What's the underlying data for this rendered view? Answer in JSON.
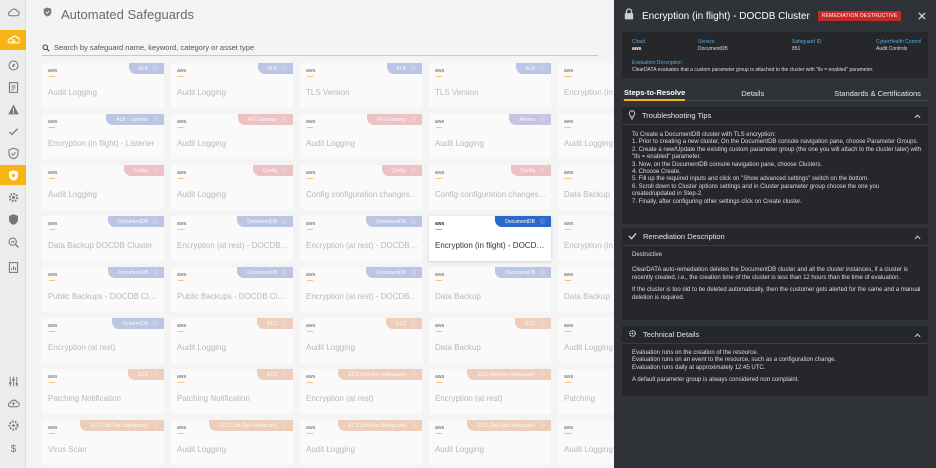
{
  "app": {
    "title": "Automated Safeguards"
  },
  "search": {
    "placeholder": "Search by safeguard name, keyword, category or asset type"
  },
  "colors": {
    "accent": "#f6b515",
    "panel_bg": "#2f3237",
    "remediation": "#c62828",
    "link": "#5fa9d8"
  },
  "rail": {
    "icons": [
      "cloud-icon",
      "cloud-shield-icon",
      "compass-icon",
      "list-icon",
      "alert-icon",
      "checkmark-icon",
      "shield-icon",
      "shield-active-icon",
      "gear-icon",
      "shield-check-icon",
      "search-analytics-icon",
      "report-icon",
      "sliders-icon",
      "cloud-upload-icon",
      "settings-icon",
      "dollar-icon"
    ]
  },
  "cards": [
    {
      "col": 0,
      "row": 0,
      "tag": "ALB",
      "color": "blue",
      "title": "Audit Logging"
    },
    {
      "col": 1,
      "row": 0,
      "tag": "ALB",
      "color": "blue",
      "title": "Audit Logging"
    },
    {
      "col": 2,
      "row": 0,
      "tag": "ALB",
      "color": "blue",
      "title": "TLS Version"
    },
    {
      "col": 3,
      "row": 0,
      "tag": "ALB",
      "color": "blue",
      "title": "TLS Version"
    },
    {
      "col": 4,
      "row": 0,
      "tag": "",
      "color": "blue",
      "title": "Encryption (in fli"
    },
    {
      "col": 0,
      "row": 1,
      "tag": "ALB - Listener",
      "color": "blue",
      "title": "Encryption (in flight) - Listener"
    },
    {
      "col": 1,
      "row": 1,
      "tag": "API Gateway",
      "color": "pink",
      "title": "Audit Logging"
    },
    {
      "col": 2,
      "row": 1,
      "tag": "API Gateway",
      "color": "pink",
      "title": "Audit Logging"
    },
    {
      "col": 3,
      "row": 1,
      "tag": "Athena",
      "color": "violet",
      "title": "Audit Logging"
    },
    {
      "col": 4,
      "row": 1,
      "tag": "",
      "color": "blue",
      "title": "Audit Logging"
    },
    {
      "col": 0,
      "row": 2,
      "tag": "Config",
      "color": "pink",
      "title": "Audit Logging"
    },
    {
      "col": 1,
      "row": 2,
      "tag": "Config",
      "color": "pink",
      "title": "Audit Logging"
    },
    {
      "col": 2,
      "row": 2,
      "tag": "Config",
      "color": "pink",
      "title": "Config configuration changes (A..."
    },
    {
      "col": 3,
      "row": 2,
      "tag": "Config",
      "color": "pink",
      "title": "Config configuration changes (A..."
    },
    {
      "col": 4,
      "row": 2,
      "tag": "",
      "color": "blue",
      "title": "Data Backup"
    },
    {
      "col": 0,
      "row": 3,
      "tag": "DocumentDB",
      "color": "blue",
      "title": "Data Backup DOCDB Cluster"
    },
    {
      "col": 1,
      "row": 3,
      "tag": "DocumentDB",
      "color": "blue",
      "title": "Encryption (at rest) - DOCDB Cl..."
    },
    {
      "col": 2,
      "row": 3,
      "tag": "DocumentDB",
      "color": "blue",
      "title": "Encryption (at rest) - DOCDB Cl..."
    },
    {
      "col": 3,
      "row": 3,
      "tag": "DocumentDB",
      "color": "darkblue",
      "title": "Encryption (in flight) - DOCDB Cl...",
      "focus": true
    },
    {
      "col": 4,
      "row": 3,
      "tag": "",
      "color": "blue",
      "title": "Encryption (in fli"
    },
    {
      "col": 0,
      "row": 4,
      "tag": "DocumentDB",
      "color": "blue",
      "title": "Public Backups - DOCDB Cluster"
    },
    {
      "col": 1,
      "row": 4,
      "tag": "DocumentDB",
      "color": "blue",
      "title": "Public Backups - DOCDB Cluster"
    },
    {
      "col": 2,
      "row": 4,
      "tag": "DocumentDB",
      "color": "blue",
      "title": "Encryption (at rest) - DOCDB Cl..."
    },
    {
      "col": 3,
      "row": 4,
      "tag": "DocumentDB",
      "color": "blue",
      "title": "Data Backup"
    },
    {
      "col": 4,
      "row": 4,
      "tag": "",
      "color": "blue",
      "title": "Data Backup"
    },
    {
      "col": 0,
      "row": 5,
      "tag": "DynamoDB",
      "color": "blue",
      "title": "Encryption (at rest)"
    },
    {
      "col": 1,
      "row": 5,
      "tag": "EC2",
      "color": "orange",
      "title": "Audit Logging"
    },
    {
      "col": 2,
      "row": 5,
      "tag": "EC2",
      "color": "orange",
      "title": "Audit Logging"
    },
    {
      "col": 3,
      "row": 5,
      "tag": "EC2",
      "color": "orange",
      "title": "Data Backup"
    },
    {
      "col": 4,
      "row": 5,
      "tag": "",
      "color": "orange",
      "title": "Audit Logging"
    },
    {
      "col": 0,
      "row": 6,
      "tag": "ECS",
      "color": "orange",
      "title": "Patching Notification"
    },
    {
      "col": 1,
      "row": 6,
      "tag": "EC2",
      "color": "orange",
      "title": "Patching Notification"
    },
    {
      "col": 2,
      "row": 6,
      "tag": "ECS (3rd Gen Safeguard)",
      "color": "orange",
      "title": "Encryption (at rest)"
    },
    {
      "col": 3,
      "row": 6,
      "tag": "ECS (3rd Gen Safeguard)",
      "color": "orange",
      "title": "Encryption (at rest)"
    },
    {
      "col": 4,
      "row": 6,
      "tag": "",
      "color": "orange",
      "title": "Patching"
    },
    {
      "col": 0,
      "row": 7,
      "tag": "ECS (3rd Gen Safeguard)",
      "color": "orange",
      "title": "Virus Scan"
    },
    {
      "col": 1,
      "row": 7,
      "tag": "ECS (3rd Gen Safeguard)",
      "color": "orange",
      "title": "Audit Logging"
    },
    {
      "col": 2,
      "row": 7,
      "tag": "ECS (3rd Gen Safeguard)",
      "color": "orange",
      "title": "Audit Logging"
    },
    {
      "col": 3,
      "row": 7,
      "tag": "ECS (3rd Gen Safeguard)",
      "color": "orange",
      "title": "Audit Logging"
    },
    {
      "col": 4,
      "row": 7,
      "tag": "",
      "color": "orange",
      "title": "Audit Logging"
    }
  ],
  "panel": {
    "title": "Encryption (in flight) - DOCDB Cluster",
    "badge": "REMEDIATION DESTRUCTIVE",
    "meta": {
      "cloud_label": "Cloud",
      "cloud_value": "aws",
      "service_label": "Service",
      "service_value": "DocumentDB",
      "safeguard_label": "Safeguard ID",
      "safeguard_value": "851",
      "cyberhealth_label": "CyberHealth Control",
      "cyberhealth_value": "Audit Controls",
      "desc_label": "Evaluation Description",
      "desc_value": "ClearDATA evaluates that a custom parameter group is attached to the cluster with \"tls = enabled\" parameter."
    },
    "tabs": [
      "Steps-to-Resolve",
      "Details",
      "Standards & Certifications"
    ],
    "troubleshooting": {
      "title": "Troubleshooting Tips",
      "lines": [
        "To Create a DocumentDB cluster with TLS encryption:",
        "1. Prior to creating a new cluster, On the DocumentDB console navigation pane, choose Parameter Groups.",
        "2. Create a new/Update the existing custom parameter group (the one you will attach to the cluster later) with \"tls = enabled\" parameter.",
        "3. Now, on the DocumentDB console navigation pane, choose Clusters.",
        "4. Choose Create.",
        "5. Fill up the required inputs and click on \"Show advanced settings\" switch on the bottom.",
        "6. Scroll down to Cluster options settings and in Cluster parameter group choose the one you created/updated in Step-2.",
        "7. Finally, after configuring other settings click on Create cluster."
      ]
    },
    "remediation": {
      "title": "Remediation Description",
      "type": "Destructive",
      "p1": "ClearDATA auto-remediation deletes the DocumentDB cluster and all the cluster instances, if a cluster is recently created, i.e., the creation time of the cluster is less than 12 hours than the time of evaluation.",
      "p2": "If the cluster is too old to be deleted automatically, then the customer gets alerted for the same and a manual deletion is required."
    },
    "technical": {
      "title": "Technical Details",
      "lines": [
        "Evaluation runs on the creation of the resource.",
        "Evaluation runs on an event to the resource, such as a configuration change.",
        "Evaluation runs daily at approximately 12:45 UTC."
      ],
      "note": "A default parameter group is always considered non complaint."
    }
  }
}
